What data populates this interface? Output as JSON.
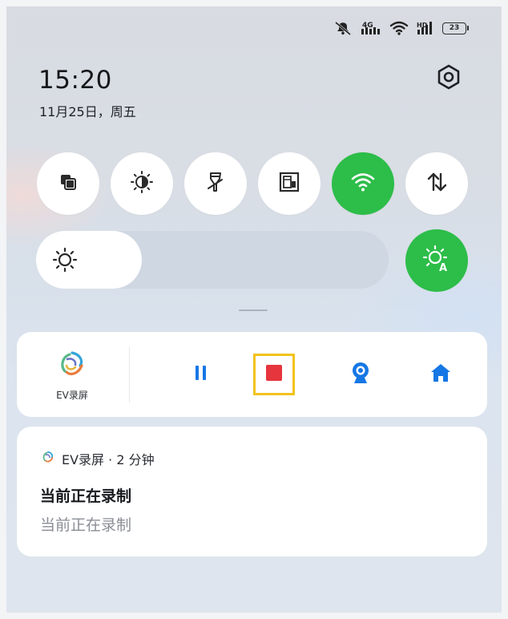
{
  "status_bar": {
    "icons": [
      "mute-bell-icon",
      "hd-signal-icon",
      "wifi-icon",
      "cellular-signal-icon"
    ],
    "battery": "23"
  },
  "header": {
    "time": "15:20",
    "date": "11月25日，周五",
    "settings_icon": "gear-icon"
  },
  "quick_tiles": [
    {
      "icon": "multi-window-icon",
      "active": false
    },
    {
      "icon": "dark-mode-icon",
      "active": false
    },
    {
      "icon": "flashlight-icon",
      "active": false
    },
    {
      "icon": "screenshot-icon",
      "active": false
    },
    {
      "icon": "wifi-icon",
      "active": true
    },
    {
      "icon": "mobile-data-icon",
      "active": false
    }
  ],
  "brightness": {
    "level": 0.3,
    "icon": "sun-icon",
    "auto_icon": "auto-brightness-icon",
    "auto_active": true
  },
  "media_control": {
    "app_name": "EV录屏",
    "controls": [
      "pause-icon",
      "stop-icon",
      "camera-icon",
      "home-icon"
    ],
    "highlighted": "stop-icon"
  },
  "notification": {
    "header": "EV录屏 · 2 分钟",
    "title": "当前正在录制",
    "body": "当前正在录制"
  },
  "colors": {
    "accent_green": "#2dbd49",
    "control_blue": "#1677e5",
    "stop_red": "#e6353d",
    "highlight_yellow": "#f2c31d"
  }
}
